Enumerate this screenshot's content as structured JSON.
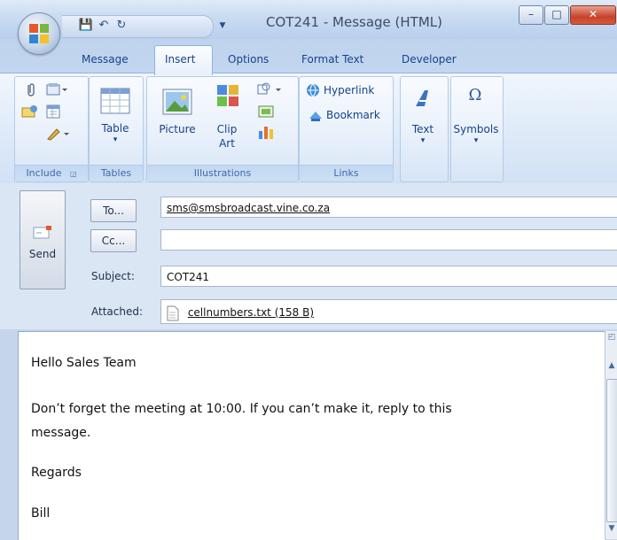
{
  "window": {
    "title": "COT241 - Message (HTML)",
    "minimize": "–",
    "maximize": "□",
    "close": "✕"
  },
  "quick_access": {
    "save": "💾",
    "undo": "↶",
    "redo": "↻",
    "more": "▼"
  },
  "tabs": [
    "Message",
    "Insert",
    "Options",
    "Format Text",
    "Developer"
  ],
  "active_tab": "Insert",
  "ribbon": {
    "groups": {
      "include": "Include",
      "tables": "Tables",
      "illustrations": "Illustrations",
      "links": "Links"
    },
    "table": "Table",
    "picture": "Picture",
    "clip_art_1": "Clip",
    "clip_art_2": "Art",
    "hyperlink": "Hyperlink",
    "bookmark": "Bookmark",
    "text": "Text",
    "symbols": "Symbols",
    "dropdown": "▾"
  },
  "header": {
    "send": "Send",
    "to_button": "To...",
    "cc_button": "Cc...",
    "subject_label": "Subject:",
    "attached_label": "Attached:",
    "to_value": "sms@smsbroadcast.vine.co.za",
    "cc_value": "",
    "subject_value": "COT241",
    "attachment": "cellnumbers.txt (158 B)"
  },
  "body": {
    "greeting": "Hello Sales Team",
    "line1": "Don’t forget the meeting at 10:00. If you can’t make it, reply to this",
    "line2": "message.",
    "regards": "Regards",
    "signature": "Bill"
  },
  "colors": {
    "accent": "#15428b",
    "ribbon": "#dde9f8",
    "close": "#c7432c"
  }
}
